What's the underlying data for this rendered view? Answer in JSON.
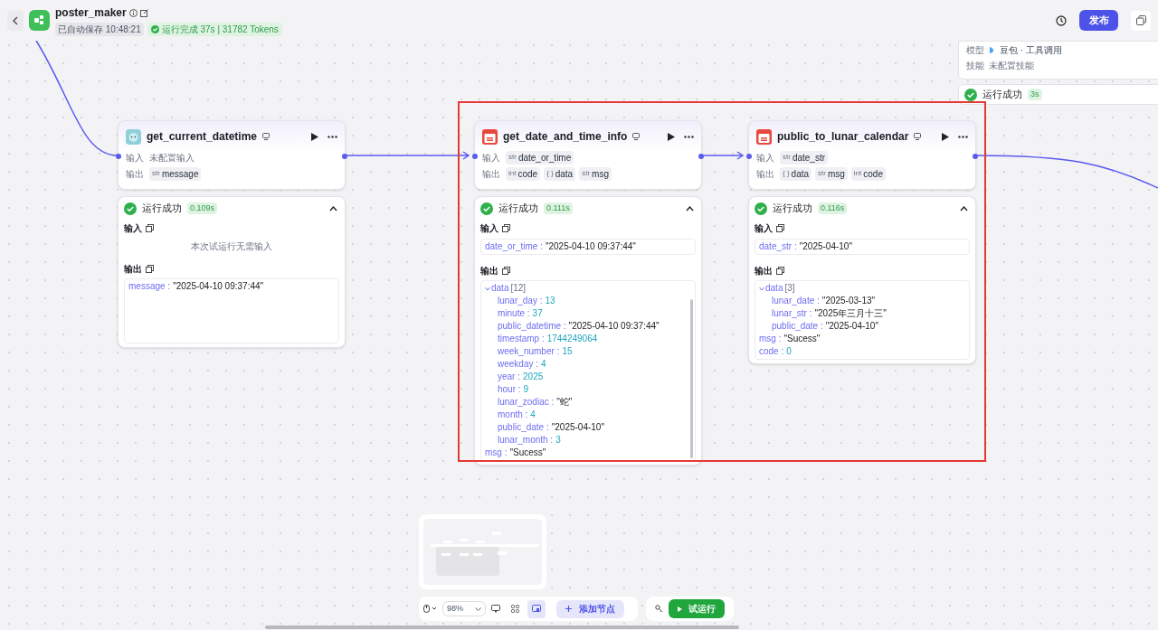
{
  "header": {
    "title": "poster_maker",
    "saved": "已自动保存 10:48:21",
    "run_status": "运行完成 37s | 31782 Tokens",
    "publish": "发布"
  },
  "agent_node": {
    "model_label": "模型",
    "model": "豆包 · 工具调用",
    "skill_label": "技能",
    "skill": "未配置技能",
    "status": "运行成功",
    "time": "3s"
  },
  "nodes": [
    {
      "title": "get_current_datetime",
      "input_label": "输入",
      "output_label": "输出",
      "inputs_empty": "未配置输入",
      "outputs": [
        {
          "type": "str",
          "name": "message"
        }
      ],
      "run": {
        "status": "运行成功",
        "time": "0.109s",
        "expanded": true,
        "input_title": "输入",
        "input_empty": "本次试运行无需输入",
        "output_title": "输出",
        "output_values": [
          {
            "key": "message :",
            "value": "\"2025-04-10 09:37:44\"",
            "kind": "string"
          }
        ]
      }
    },
    {
      "title": "get_date_and_time_info",
      "input_label": "输入",
      "output_label": "输出",
      "inputs": [
        {
          "type": "str",
          "name": "date_or_time"
        }
      ],
      "outputs": [
        {
          "type": "int",
          "name": "code"
        },
        {
          "type": "{ }",
          "name": "data"
        },
        {
          "type": "str",
          "name": "msg"
        }
      ],
      "run": {
        "status": "运行成功",
        "time": "0.111s",
        "expanded": true,
        "input_title": "输入",
        "input_values": [
          {
            "key": "date_or_time :",
            "value": "\"2025-04-10 09:37:44\"",
            "kind": "string"
          }
        ],
        "output_title": "输出",
        "output_values": [
          {
            "key": "data",
            "count": "[12]",
            "kind": "object",
            "expanded": true,
            "children": [
              {
                "key": "lunar_day :",
                "value": "13",
                "kind": "number"
              },
              {
                "key": "minute :",
                "value": "37",
                "kind": "number"
              },
              {
                "key": "public_datetime :",
                "value": "\"2025-04-10 09:37:44\"",
                "kind": "string"
              },
              {
                "key": "timestamp :",
                "value": "1744249064",
                "kind": "number"
              },
              {
                "key": "week_number :",
                "value": "15",
                "kind": "number"
              },
              {
                "key": "weekday :",
                "value": "4",
                "kind": "number"
              },
              {
                "key": "year :",
                "value": "2025",
                "kind": "number"
              },
              {
                "key": "hour :",
                "value": "9",
                "kind": "number"
              },
              {
                "key": "lunar_zodiac :",
                "value": "\"蛇\"",
                "kind": "string"
              },
              {
                "key": "month :",
                "value": "4",
                "kind": "number"
              },
              {
                "key": "public_date :",
                "value": "\"2025-04-10\"",
                "kind": "string"
              },
              {
                "key": "lunar_month :",
                "value": "3",
                "kind": "number"
              }
            ]
          },
          {
            "key": "msg :",
            "value": "\"Sucess\"",
            "kind": "string"
          }
        ]
      }
    },
    {
      "title": "public_to_lunar_calendar",
      "input_label": "输入",
      "output_label": "输出",
      "inputs": [
        {
          "type": "str",
          "name": "date_str"
        }
      ],
      "outputs": [
        {
          "type": "{ }",
          "name": "data"
        },
        {
          "type": "str",
          "name": "msg"
        },
        {
          "type": "int",
          "name": "code"
        }
      ],
      "run": {
        "status": "运行成功",
        "time": "0.116s",
        "expanded": true,
        "input_title": "输入",
        "input_values": [
          {
            "key": "date_str :",
            "value": "\"2025-04-10\"",
            "kind": "string"
          }
        ],
        "output_title": "输出",
        "output_values": [
          {
            "key": "data",
            "count": "[3]",
            "kind": "object",
            "expanded": true,
            "children": [
              {
                "key": "lunar_date :",
                "value": "\"2025-03-13\"",
                "kind": "string"
              },
              {
                "key": "lunar_str :",
                "value": "\"2025年三月十三\"",
                "kind": "string"
              },
              {
                "key": "public_date :",
                "value": "\"2025-04-10\"",
                "kind": "string"
              }
            ]
          },
          {
            "key": "msg :",
            "value": "\"Sucess\"",
            "kind": "string"
          },
          {
            "key": "code :",
            "value": "0",
            "kind": "number"
          }
        ]
      }
    }
  ],
  "toolbar": {
    "zoom": "98%",
    "minimap_on": true,
    "add_node": "添加节点",
    "test_run": "试运行"
  }
}
